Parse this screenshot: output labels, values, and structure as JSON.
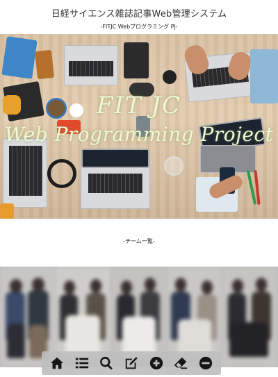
{
  "header": {
    "title": "日経サイエンス雑誌記事Web管理システム",
    "subtitle": "-FITJC Webプログラミング PJ-"
  },
  "hero": {
    "line1": "FIT JC",
    "line2": "Web Programming Project"
  },
  "team": {
    "label": "-チーム一覧-"
  },
  "toolbar": {
    "items": [
      {
        "name": "home-icon"
      },
      {
        "name": "list-icon"
      },
      {
        "name": "search-icon"
      },
      {
        "name": "edit-icon"
      },
      {
        "name": "add-icon"
      },
      {
        "name": "eraser-icon"
      },
      {
        "name": "remove-icon"
      }
    ]
  }
}
